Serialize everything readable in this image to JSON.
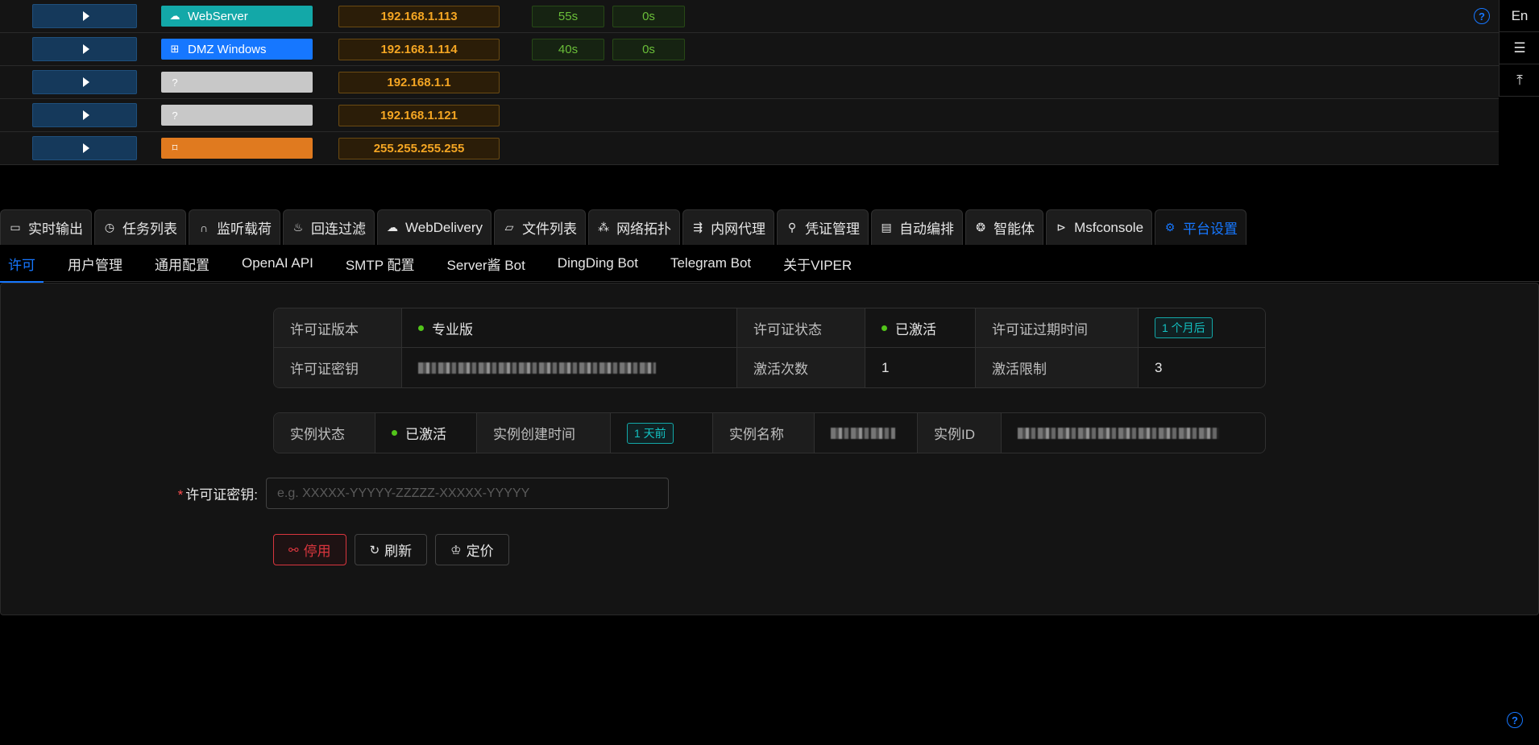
{
  "hosts": [
    {
      "os_label": "WebServer",
      "os_icon": "cloud-icon",
      "os_color": "#13a8a8",
      "ip": "192.168.1.113",
      "t1": "55s",
      "t2": "0s"
    },
    {
      "os_label": "DMZ Windows",
      "os_icon": "windows-icon",
      "os_color": "#1677ff",
      "ip": "192.168.1.114",
      "t1": "40s",
      "t2": "0s"
    },
    {
      "os_label": "",
      "os_icon": "question-icon",
      "os_color": "#c8c8c8",
      "ip": "192.168.1.1"
    },
    {
      "os_label": "",
      "os_icon": "question-icon",
      "os_color": "#c8c8c8",
      "ip": "192.168.1.121"
    },
    {
      "os_label": "",
      "os_icon": "gateway-icon",
      "os_color": "#e07a1f",
      "ip": "255.255.255.255"
    }
  ],
  "side_tools": {
    "lang": "En"
  },
  "main_tabs": [
    {
      "label": "实时输出",
      "icon": "monitor-icon"
    },
    {
      "label": "任务列表",
      "icon": "clock-icon"
    },
    {
      "label": "监听载荷",
      "icon": "headphones-icon"
    },
    {
      "label": "回连过滤",
      "icon": "fire-icon"
    },
    {
      "label": "WebDelivery",
      "icon": "cloud-upload-icon"
    },
    {
      "label": "文件列表",
      "icon": "folder-icon"
    },
    {
      "label": "网络拓扑",
      "icon": "topology-icon"
    },
    {
      "label": "内网代理",
      "icon": "proxy-icon"
    },
    {
      "label": "凭证管理",
      "icon": "key-search-icon"
    },
    {
      "label": "自动编排",
      "icon": "book-icon"
    },
    {
      "label": "智能体",
      "icon": "ai-icon"
    },
    {
      "label": "Msfconsole",
      "icon": "terminal-icon"
    },
    {
      "label": "平台设置",
      "icon": "gear-icon",
      "active": true
    }
  ],
  "sub_tabs": [
    "许可",
    "用户管理",
    "通用配置",
    "OpenAI API",
    "SMTP 配置",
    "Server酱 Bot",
    "DingDing Bot",
    "Telegram Bot",
    "关于VIPER"
  ],
  "license": {
    "version_label": "许可证版本",
    "version_value": "专业版",
    "status_label": "许可证状态",
    "status_value": "已激活",
    "expire_label": "许可证过期时间",
    "expire_value": "1 个月后",
    "key_label": "许可证密钥",
    "count_label": "激活次数",
    "count_value": "1",
    "limit_label": "激活限制",
    "limit_value": "3"
  },
  "instance": {
    "status_label": "实例状态",
    "status_value": "已激活",
    "created_label": "实例创建时间",
    "created_value": "1 天前",
    "name_label": "实例名称",
    "id_label": "实例ID"
  },
  "form": {
    "key_label": "许可证密钥:",
    "key_placeholder": "e.g. XXXXX-YYYYY-ZZZZZ-XXXXX-YYYYY"
  },
  "buttons": {
    "deactivate": "停用",
    "refresh": "刷新",
    "pricing": "定价"
  }
}
